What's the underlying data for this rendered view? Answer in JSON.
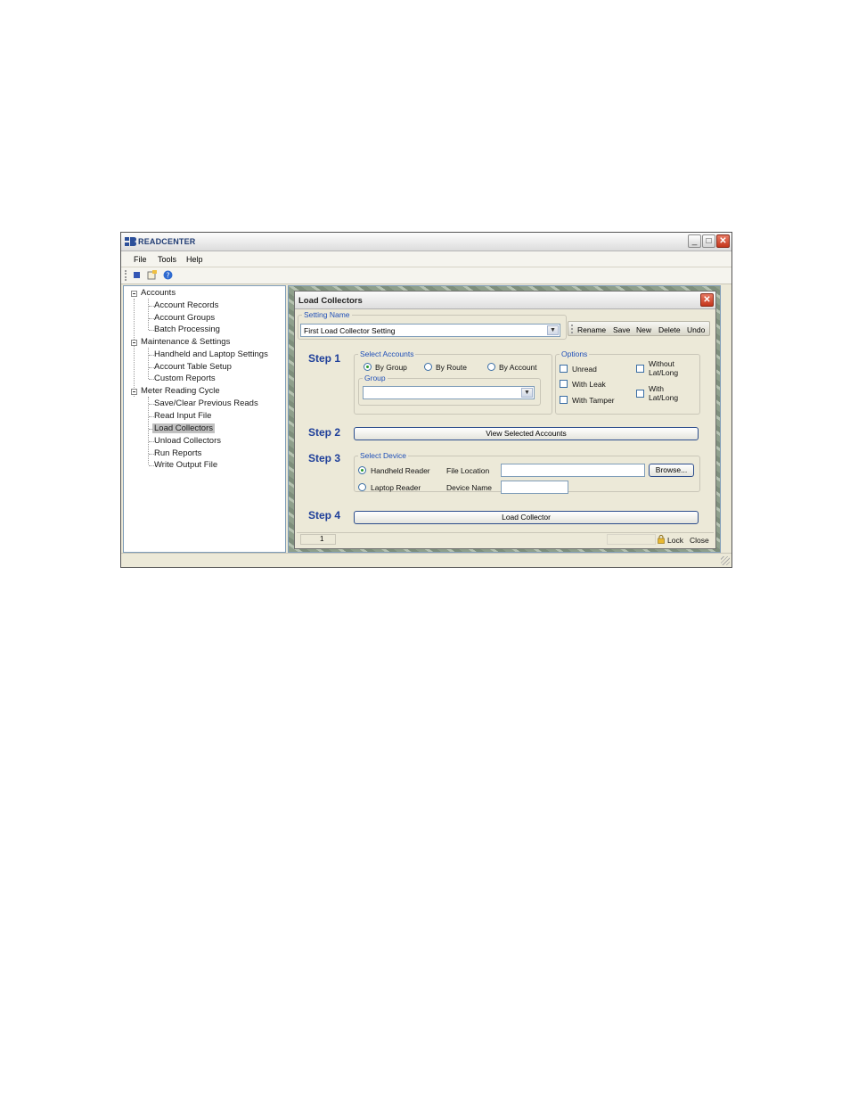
{
  "window": {
    "title": "READCENTER",
    "minimize_glyph": "_",
    "maximize_glyph": "□",
    "close_glyph": "✕"
  },
  "menu": [
    {
      "label": "File"
    },
    {
      "label": "Tools"
    },
    {
      "label": "Help"
    }
  ],
  "toolbar": {
    "icons": [
      "stop-icon",
      "properties-icon",
      "help-icon"
    ]
  },
  "tree": {
    "groups": [
      {
        "label": "Accounts",
        "children": [
          "Account Records",
          "Account Groups",
          "Batch Processing"
        ]
      },
      {
        "label": "Maintenance & Settings",
        "children": [
          "Handheld and Laptop Settings",
          "Account Table Setup",
          "Custom Reports"
        ]
      },
      {
        "label": "Meter Reading Cycle",
        "children": [
          "Save/Clear Previous Reads",
          "Read Input File",
          "Load Collectors",
          "Unload Collectors",
          "Run Reports",
          "Write Output File"
        ]
      }
    ],
    "selected": "Load Collectors"
  },
  "dialog": {
    "title": "Load Collectors",
    "close_glyph": "✕",
    "setting_name": {
      "legend": "Setting Name",
      "value": "First Load Collector Setting",
      "arrow": "▼"
    },
    "actions": [
      "Rename",
      "Save",
      "New",
      "Delete",
      "Undo"
    ],
    "step1": {
      "label": "Step 1",
      "select_accounts_legend": "Select Accounts",
      "radios": [
        {
          "label": "By Group",
          "checked": true
        },
        {
          "label": "By Route",
          "checked": false
        },
        {
          "label": "By Account",
          "checked": false
        }
      ],
      "group_legend": "Group",
      "group_value": "",
      "group_arrow": "▼",
      "options_legend": "Options",
      "options": [
        {
          "label": "Unread"
        },
        {
          "label": "With Leak"
        },
        {
          "label": "With Tamper"
        }
      ],
      "options_right": [
        {
          "line1": "Without",
          "line2": "Lat/Long"
        },
        {
          "line1": "With",
          "line2": "Lat/Long"
        }
      ]
    },
    "step2": {
      "label": "Step 2",
      "button": "View Selected Accounts"
    },
    "step3": {
      "label": "Step 3",
      "legend": "Select Device",
      "handheld": "Handheld Reader",
      "laptop": "Laptop Reader",
      "file_location_label": "File Location",
      "file_location_value": "",
      "browse": "Browse...",
      "device_name_label": "Device Name",
      "device_name_value": ""
    },
    "step4": {
      "label": "Step 4",
      "button": "Load Collector"
    },
    "status": {
      "count": "1",
      "lock": "Lock",
      "close": "Close"
    }
  }
}
